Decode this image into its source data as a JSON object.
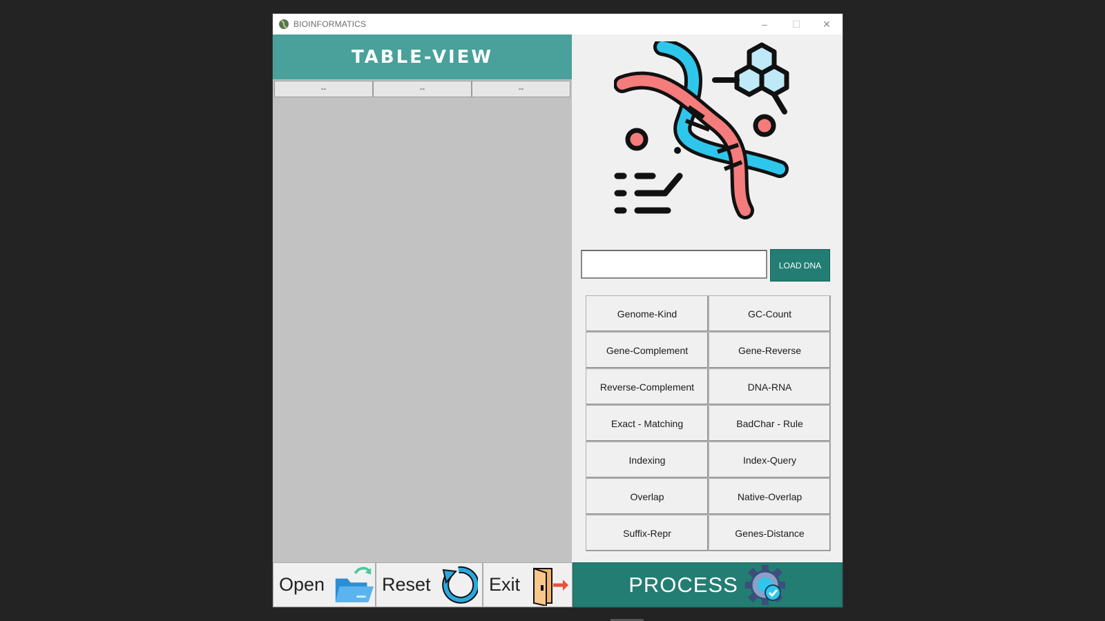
{
  "window": {
    "title": "BIOINFORMATICS",
    "controls": {
      "minimize": "–",
      "maximize": "☐",
      "close": "✕"
    }
  },
  "table": {
    "banner_title": "TABLE-VIEW",
    "columns": [
      "--",
      "--",
      "--"
    ]
  },
  "dna_input": {
    "value": "",
    "placeholder": ""
  },
  "load_button": "LOAD DNA",
  "operations": [
    "Genome-Kind",
    "GC-Count",
    "Gene-Complement",
    "Gene-Reverse",
    "Reverse-Complement",
    "DNA-RNA",
    "Exact - Matching",
    "BadChar - Rule",
    "Indexing",
    "Index-Query",
    "Overlap",
    "Native-Overlap",
    "Suffix-Repr",
    "Genes-Distance"
  ],
  "bottom": {
    "open": "Open",
    "reset": "Reset",
    "exit": "Exit",
    "process": "PROCESS"
  },
  "colors": {
    "banner": "#4aa09a",
    "accent": "#237d73",
    "dna_blue": "#2fc6ec",
    "dna_red": "#f47c7c"
  },
  "icons": {
    "app": "dna-app-icon",
    "open": "folder-open-icon",
    "reset": "refresh-icon",
    "exit": "exit-door-icon",
    "process": "gear-check-icon"
  }
}
